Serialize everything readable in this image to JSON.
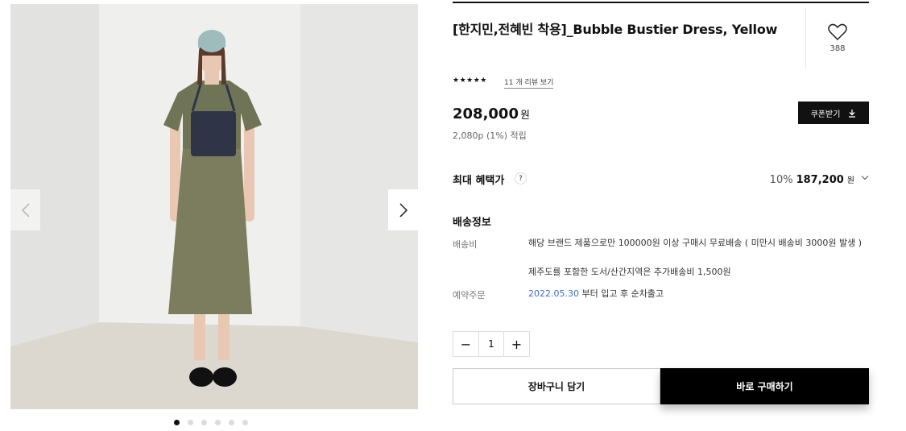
{
  "product": {
    "title": "[한지민,전혜빈 착용]_Bubble Bustier Dress, Yellow",
    "wish_count": "388",
    "rating_stars": "★★★★★",
    "review_link": "11 개 리뷰 보기",
    "price": "208,000",
    "price_unit": "원",
    "points": "2,080p (1%) 적립",
    "coupon_button": "쿠폰받기"
  },
  "benefit": {
    "label": "최대 혜택가",
    "help": "?",
    "percent": "10%",
    "amount": "187,200",
    "unit": "원"
  },
  "shipping": {
    "title": "배송정보",
    "fee_label": "배송비",
    "fee_line1": "해당 브랜드 제품으로만 100000원 이상 구매시 무료배송 ( 미만시 배송비 3000원 발생 )",
    "fee_line2": "제주도를 포함한 도서/산간지역은 추가배송비 1,500원",
    "preorder_label": "예약주문",
    "preorder_date": "2022.05.30",
    "preorder_text": " 부터 입고 후 순차출고"
  },
  "quantity": {
    "minus": "−",
    "value": "1",
    "plus": "+"
  },
  "actions": {
    "cart": "장바구니 담기",
    "buy": "바로 구매하기"
  },
  "gallery": {
    "total_images": 6,
    "active_index": 0
  },
  "icons": [
    "chevron-left-icon",
    "chevron-right-icon",
    "heart-icon",
    "download-icon",
    "chevron-down-icon"
  ],
  "colors": {
    "button_dark": "#111111",
    "date_link": "#3b6fc7"
  }
}
